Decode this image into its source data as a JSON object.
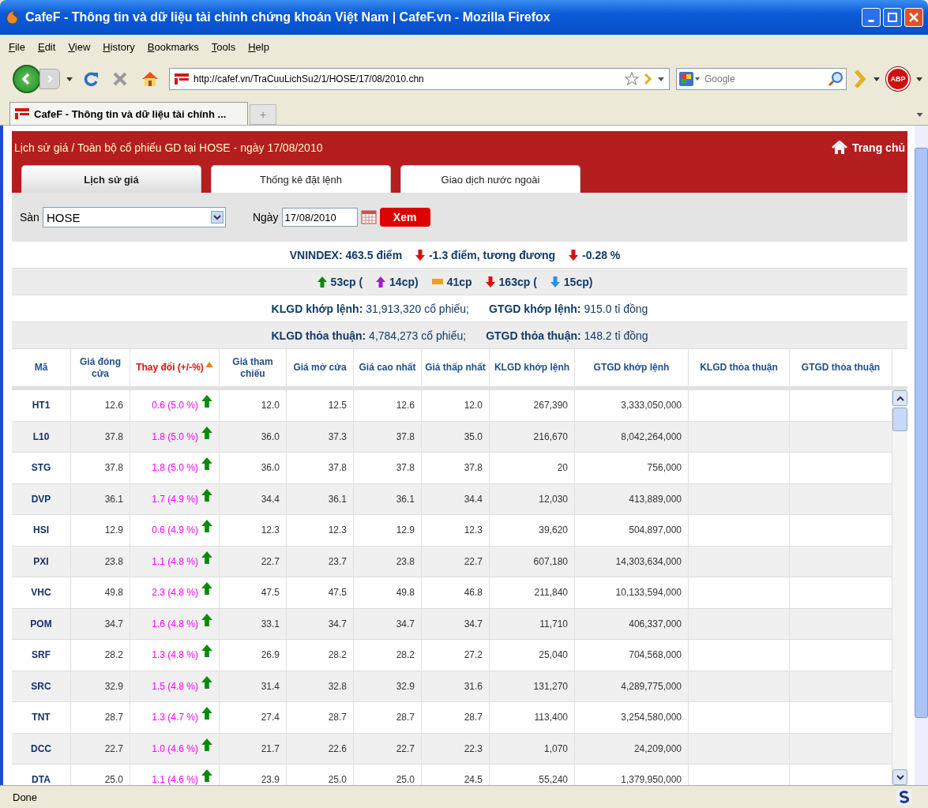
{
  "window": {
    "title": "CafeF - Thông tin và dữ liệu tài chính chứng khoán Việt Nam | CafeF.vn - Mozilla Firefox"
  },
  "menu": [
    "File",
    "Edit",
    "View",
    "History",
    "Bookmarks",
    "Tools",
    "Help"
  ],
  "toolbar": {
    "url": "http://cafef.vn/TraCuuLichSu2/1/HOSE/17/08/2010.chn",
    "search_placeholder": "Google",
    "addon_label": "ABP"
  },
  "browser_tabs": [
    {
      "label": "CafeF - Thông tin và dữ liệu tài chính ...",
      "selected": true
    }
  ],
  "new_tab": "+",
  "page": {
    "breadcrumb": "Lịch sử giá / Toàn bộ cổ phiếu GD tại HOSE - ngày 17/08/2010",
    "home_link": "Trang chủ",
    "tabs": [
      {
        "label": "Lịch sử giá",
        "selected": true
      },
      {
        "label": "Thống kê đặt lệnh",
        "selected": false
      },
      {
        "label": "Giao dịch nước ngoài",
        "selected": false
      }
    ],
    "filter": {
      "exchange_label": "Sàn",
      "exchange_value": "HOSE",
      "date_label": "Ngày",
      "date_value": "17/08/2010",
      "submit": "Xem"
    },
    "summary": [
      [
        {
          "kind": "plain",
          "text": "VNINDEX: 463.5 điểm"
        },
        {
          "kind": "down",
          "text": "-1.3 điểm, tương đương"
        },
        {
          "kind": "down",
          "text": "-0.28 %"
        }
      ],
      [
        {
          "kind": "up",
          "text": "53cp ("
        },
        {
          "kind": "ceiling",
          "text": "14cp)"
        },
        {
          "kind": "flat",
          "text": "41cp"
        },
        {
          "kind": "down",
          "text": "163cp ("
        },
        {
          "kind": "floor",
          "text": "15cp)"
        }
      ]
    ],
    "totals": [
      [
        "**KLGD khớp lệnh:** 31,913,320 cổ phiếu;",
        "**GTGD khớp lệnh:** 915.0 tỉ đồng"
      ],
      [
        "**KLGD thỏa thuận:** 4,784,273 cổ phiếu;",
        "**GTGD thỏa thuận:** 148.2 tỉ đồng"
      ]
    ],
    "table": {
      "columns": [
        {
          "label": "Mã",
          "sorted": false
        },
        {
          "label": "Giá đóng cửa",
          "sorted": false
        },
        {
          "label": "Thay đổi (+/-%)",
          "sorted": true
        },
        {
          "label": "Giá tham chiếu",
          "sorted": false
        },
        {
          "label": "Giá mở cửa",
          "sorted": false
        },
        {
          "label": "Giá cao nhất",
          "sorted": false
        },
        {
          "label": "Giá thấp nhất",
          "sorted": false
        },
        {
          "label": "KLGD khớp lệnh",
          "sorted": false
        },
        {
          "label": "GTGD khớp lệnh",
          "sorted": false
        },
        {
          "label": "KLGD thỏa thuận",
          "sorted": false
        },
        {
          "label": "GTGD thỏa thuận",
          "sorted": false
        }
      ],
      "rows": [
        {
          "kind": "up",
          "code": "HT1",
          "close": "12.6",
          "change": "0.6 (5.0 %)",
          "ref": "12.0",
          "open": "12.5",
          "high": "12.6",
          "low": "12.0",
          "volume": "267,390",
          "value": "3,333,050,000"
        },
        {
          "kind": "up",
          "code": "L10",
          "close": "37.8",
          "change": "1.8 (5.0 %)",
          "ref": "36.0",
          "open": "37.3",
          "high": "37.8",
          "low": "35.0",
          "volume": "216,670",
          "value": "8,042,264,000"
        },
        {
          "kind": "up",
          "code": "STG",
          "close": "37.8",
          "change": "1.8 (5.0 %)",
          "ref": "36.0",
          "open": "37.8",
          "high": "37.8",
          "low": "37.8",
          "volume": "20",
          "value": "756,000"
        },
        {
          "kind": "up",
          "code": "DVP",
          "close": "36.1",
          "change": "1.7 (4.9 %)",
          "ref": "34.4",
          "open": "36.1",
          "high": "36.1",
          "low": "34.4",
          "volume": "12,030",
          "value": "413,889,000"
        },
        {
          "kind": "up",
          "code": "HSI",
          "close": "12.9",
          "change": "0.6 (4.9 %)",
          "ref": "12.3",
          "open": "12.3",
          "high": "12.9",
          "low": "12.3",
          "volume": "39,620",
          "value": "504,897,000"
        },
        {
          "kind": "up",
          "code": "PXI",
          "close": "23.8",
          "change": "1.1 (4.8 %)",
          "ref": "22.7",
          "open": "23.7",
          "high": "23.8",
          "low": "22.7",
          "volume": "607,180",
          "value": "14,303,634,000"
        },
        {
          "kind": "up",
          "code": "VHC",
          "close": "49.8",
          "change": "2.3 (4.8 %)",
          "ref": "47.5",
          "open": "47.5",
          "high": "49.8",
          "low": "46.8",
          "volume": "211,840",
          "value": "10,133,594,000"
        },
        {
          "kind": "up",
          "code": "POM",
          "close": "34.7",
          "change": "1.6 (4.8 %)",
          "ref": "33.1",
          "open": "34.7",
          "high": "34.7",
          "low": "34.7",
          "volume": "11,710",
          "value": "406,337,000"
        },
        {
          "kind": "up",
          "code": "SRF",
          "close": "28.2",
          "change": "1.3 (4.8 %)",
          "ref": "26.9",
          "open": "28.2",
          "high": "28.2",
          "low": "27.2",
          "volume": "25,040",
          "value": "704,568,000"
        },
        {
          "kind": "up",
          "code": "SRC",
          "close": "32.9",
          "change": "1.5 (4.8 %)",
          "ref": "31.4",
          "open": "32.8",
          "high": "32.9",
          "low": "31.6",
          "volume": "131,270",
          "value": "4,289,775,000"
        },
        {
          "kind": "up",
          "code": "TNT",
          "close": "28.7",
          "change": "1.3 (4.7 %)",
          "ref": "27.4",
          "open": "28.7",
          "high": "28.7",
          "low": "28.7",
          "volume": "113,400",
          "value": "3,254,580,000"
        },
        {
          "kind": "up",
          "code": "DCC",
          "close": "22.7",
          "change": "1.0 (4.6 %)",
          "ref": "21.7",
          "open": "22.6",
          "high": "22.7",
          "low": "22.3",
          "volume": "1,070",
          "value": "24,209,000"
        },
        {
          "kind": "up",
          "code": "DTA",
          "close": "25.0",
          "change": "1.1 (4.6 %)",
          "ref": "23.9",
          "open": "25.0",
          "high": "25.0",
          "low": "24.5",
          "volume": "55,240",
          "value": "1,379,950,000"
        }
      ]
    }
  },
  "status_bar": {
    "text": "Done"
  }
}
